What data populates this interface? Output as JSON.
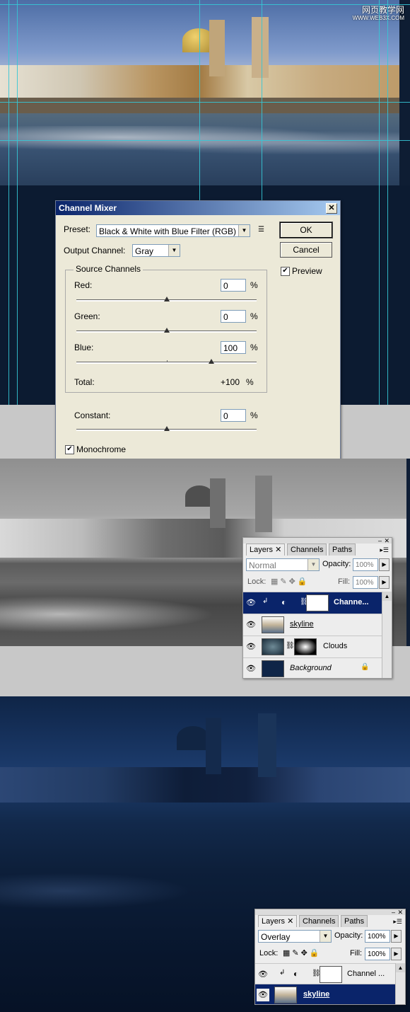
{
  "watermark": {
    "line1": "网页教学网",
    "line2": "WWW.WEB3X.COM"
  },
  "channel_mixer": {
    "title": "Channel Mixer",
    "preset_label": "Preset:",
    "preset_value": "Black & White with Blue Filter (RGB)",
    "ok_label": "OK",
    "cancel_label": "Cancel",
    "preview_label": "Preview",
    "preview_checked": "✔",
    "output_channel_label": "Output Channel:",
    "output_channel_value": "Gray",
    "source_channels_label": "Source Channels",
    "red_label": "Red:",
    "red_value": "0",
    "green_label": "Green:",
    "green_value": "0",
    "blue_label": "Blue:",
    "blue_value": "100",
    "percent": "%",
    "total_label": "Total:",
    "total_value": "+100",
    "constant_label": "Constant:",
    "constant_value": "0",
    "monochrome_label": "Monochrome",
    "monochrome_checked": "✔"
  },
  "layers1": {
    "tabs": [
      "Layers",
      "Channels",
      "Paths"
    ],
    "blend_mode": "Normal",
    "opacity_label": "Opacity:",
    "opacity_value": "100%",
    "lock_label": "Lock:",
    "fill_label": "Fill:",
    "fill_value": "100%",
    "layers": [
      {
        "name": "Channe...",
        "selected": true
      },
      {
        "name": "skyline",
        "selected": false
      },
      {
        "name": "Clouds",
        "selected": false
      },
      {
        "name": "Background",
        "selected": false
      }
    ]
  },
  "layers2": {
    "tabs": [
      "Layers",
      "Channels",
      "Paths"
    ],
    "blend_mode": "Overlay",
    "opacity_label": "Opacity:",
    "opacity_value": "100%",
    "lock_label": "Lock:",
    "fill_label": "Fill:",
    "fill_value": "100%",
    "layers": [
      {
        "name": "Channel ...",
        "selected": false
      },
      {
        "name": "skyline",
        "selected": true
      }
    ]
  }
}
